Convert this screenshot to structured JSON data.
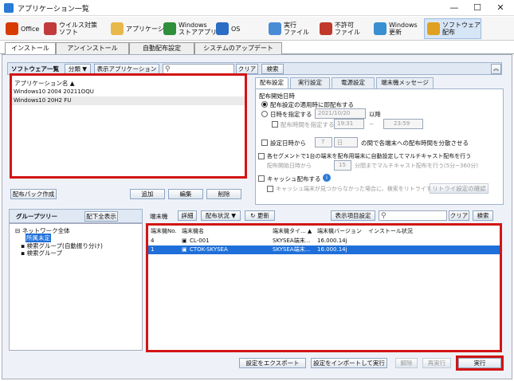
{
  "window": {
    "title": "アプリケーション一覧",
    "min": "—",
    "max": "☐",
    "close": "✕"
  },
  "toolbar": [
    {
      "label": "Office",
      "color": "#d83b01"
    },
    {
      "label": "ウイルス対策\nソフト",
      "color": "#c23b3b"
    },
    {
      "label": "アプリケーション",
      "color": "#e8b84a"
    },
    {
      "label": "Windows\nストアアプリ",
      "color": "#2f8f3a"
    },
    {
      "label": "OS",
      "color": "#2b6cc4"
    },
    {
      "label": "実行\nファイル",
      "color": "#4a8bd6"
    },
    {
      "label": "不許可\nファイル",
      "color": "#c0392b"
    },
    {
      "label": "Windows\n更新",
      "color": "#3a8fd0"
    },
    {
      "label": "ソフトウェア\n配布",
      "color": "#e0a020"
    }
  ],
  "tabs": [
    "インストール",
    "アンインストール",
    "自動配布設定",
    "システムのアップデート"
  ],
  "software_list": {
    "title": "ソフトウェア一覧",
    "category_btn": "分類 ▼",
    "display_btn": "表示アプリケーション ▼",
    "clear": "クリア",
    "search": "検索",
    "col_header": "アプリケーション名 ▲",
    "items": [
      "Windows10 2004 20211OQU",
      "Windows10 20H2 FU"
    ],
    "create_pack": "配布パック作成",
    "add": "追加",
    "edit": "編集",
    "delete": "削除"
  },
  "settings": {
    "tabs": [
      "配布設定",
      "実行設定",
      "電源設定",
      "端末機メッセージ"
    ],
    "start_group": "配布開始日時",
    "opt_immediate": "配布設定の適用時に即配布する",
    "opt_datetime": "日時を指定する",
    "date": "2021/10/20",
    "after": "以降",
    "spec_time": "配布時間を指定する",
    "time1": "19:31",
    "tilde": "~",
    "time2": "23:59",
    "spread_prefix": "設定日時から",
    "spread_days": "7",
    "spread_unit": "日",
    "spread_suffix": "の間で各端末への配布時間を分散させる",
    "multicast_label": "各セグメントで1台の端末を配布用端末に自動設定してマルチキャスト配布を行う",
    "mc_from": "配布開始日時から",
    "mc_min": "15",
    "mc_suffix": "分間までマルチキャスト配布を行う(5分~360分)",
    "cache_label": "キャッシュ配布する",
    "cache_sub": "キャッシュ端末が見つからなかった場合に、検索をリトライする",
    "retry_btn": "リトライ設定の確認"
  },
  "group_tree": {
    "title": "グループツリー",
    "show_btn": "配下全表示",
    "root": "ネットワーク全体",
    "unassigned": "所属未定",
    "auto_search": "検索グループ(自動振り分け)",
    "search_group": "検索グループ"
  },
  "terminal": {
    "label": "端末機",
    "detail": "詳細",
    "status": "配布状況 ▼",
    "refresh": "更新",
    "display_settings": "表示項目設定",
    "clear": "クリア",
    "search": "検索",
    "cols": [
      "端末機No.",
      "端末機名",
      "端末機タイ... ▲",
      "端末機バージョン",
      "インストール状況"
    ],
    "rows": [
      [
        "4",
        "CL-001",
        "SKYSEA端末...",
        "16.000.14j",
        ""
      ],
      [
        "1",
        "CTOK-SKYSEA",
        "SKYSEA端末...",
        "16.000.14j",
        ""
      ]
    ]
  },
  "footer": {
    "export": "設定をエクスポート",
    "import": "設定をインポートして実行",
    "cancel": "解除",
    "rerun": "再実行",
    "run": "実行"
  }
}
